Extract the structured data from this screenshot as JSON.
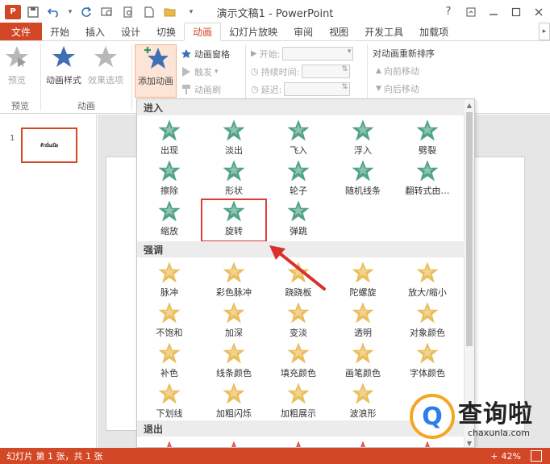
{
  "window": {
    "title": "演示文稿1 - PowerPoint",
    "logo_text": "P",
    "help": "?",
    "buttons": [
      "restore",
      "minimize",
      "maximize",
      "close"
    ]
  },
  "qat_icons": [
    "save-icon",
    "undo-icon",
    "redo-icon",
    "repeat-icon",
    "new-icon",
    "open-folder-icon",
    "customize-icon"
  ],
  "tabs": [
    {
      "label": "文件",
      "kind": "file"
    },
    {
      "label": "开始"
    },
    {
      "label": "插入"
    },
    {
      "label": "设计"
    },
    {
      "label": "切换"
    },
    {
      "label": "动画",
      "active": true
    },
    {
      "label": "幻灯片放映"
    },
    {
      "label": "审阅"
    },
    {
      "label": "视图"
    },
    {
      "label": "开发工具"
    },
    {
      "label": "加载项"
    }
  ],
  "ribbon": {
    "preview": {
      "button": "预览",
      "group": "预览"
    },
    "animation": {
      "style_button": "动画样式",
      "effect_button": "效果选项",
      "group": "动画"
    },
    "advanced": {
      "add_button": "添加动画",
      "pane": "动画窗格",
      "trigger": "触发",
      "painter": "动画刷"
    },
    "timing": {
      "start": "开始:",
      "duration": "持续时间:",
      "delay": "延迟:"
    },
    "reorder": {
      "title": "对动画重新排序",
      "forward": "向前移动",
      "backward": "向后移动"
    }
  },
  "slide_pane": {
    "number": "1",
    "thumb_text": "ดิวนั่นเนีย"
  },
  "gallery": {
    "sections": [
      {
        "title": "进入",
        "items": [
          "出现",
          "淡出",
          "飞入",
          "浮入",
          "劈裂",
          "擦除",
          "形状",
          "轮子",
          "随机线条",
          "翻转式由…",
          "缩放",
          "旋转",
          "弹跳"
        ]
      },
      {
        "title": "强调",
        "items": [
          "脉冲",
          "彩色脉冲",
          "跷跷板",
          "陀螺旋",
          "放大/缩小",
          "不饱和",
          "加深",
          "变淡",
          "透明",
          "对象颜色",
          "补色",
          "线条颜色",
          "填充颜色",
          "画笔颜色",
          "字体颜色",
          "下划线",
          "加粗闪烁",
          "加粗展示",
          "波浪形"
        ]
      },
      {
        "title": "退出",
        "items": [
          "",
          "",
          "",
          "",
          ""
        ]
      }
    ],
    "selected": "旋转",
    "colors": {
      "enter": "#3f9a7a",
      "emphasis": "#e8b84a",
      "exit": "#d9493a",
      "highlight": "#e03b3b"
    }
  },
  "statusbar": {
    "text": "幻灯片 第 1 张，共 1 张",
    "zoom": "42%"
  },
  "watermark": {
    "q": "Q",
    "title": "查询啦",
    "url": "chaxunla.com"
  }
}
